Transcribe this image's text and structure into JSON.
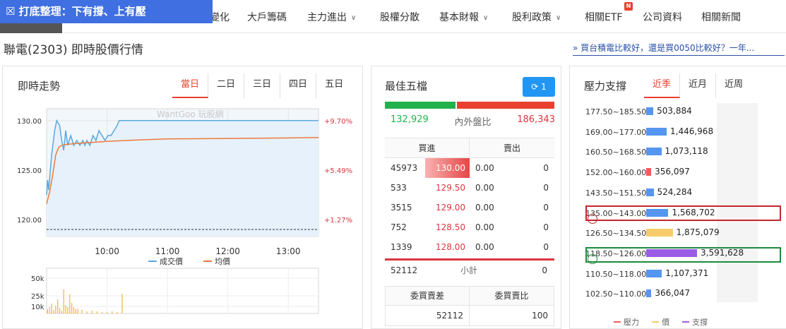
{
  "nav": {
    "banner": "☒ 打底整理：下有撐、上有壓",
    "items": [
      "變化",
      "大戶籌碼",
      "主力進出",
      "股權分散",
      "基本財報",
      "股利政策",
      "相關ETF",
      "公司資料",
      "相關新聞"
    ],
    "etf_badge": "N"
  },
  "page": {
    "title": "聯電(2303) 即時股價行情",
    "promo": "» 買台積電比較好，還是買0050比較好？一年..."
  },
  "trend": {
    "title": "即時走勢",
    "tabs": [
      "當日",
      "二日",
      "三日",
      "四日",
      "五日"
    ],
    "active_tab": 0,
    "watermark": "WantGoo 玩股網",
    "legend_price": "成交價",
    "legend_avg": "均價",
    "price_color": "#5ba8de",
    "avg_color": "#f07a3a"
  },
  "chart_data": [
    {
      "type": "line",
      "title": "",
      "x_ticks": [
        "10:00",
        "11:00",
        "12:00",
        "13:00"
      ],
      "y_ticks": [
        "130.00",
        "125.00",
        "120.00"
      ],
      "y_ticks_right": [
        "+9.70%",
        "+5.49%",
        "+1.27%"
      ],
      "ylim": [
        118.3,
        131.2
      ],
      "grid": true,
      "series": [
        {
          "name": "成交價",
          "x": [
            "09:00",
            "09:01",
            "09:02",
            "09:05",
            "09:08",
            "09:10",
            "09:13",
            "09:15",
            "09:17",
            "09:19",
            "09:21",
            "09:24",
            "09:27",
            "09:30",
            "09:33",
            "09:36",
            "09:38",
            "09:40",
            "09:43",
            "09:46",
            "09:49",
            "09:52",
            "09:55",
            "09:58",
            "10:01",
            "10:04",
            "10:07",
            "10:10",
            "10:12",
            "10:15",
            "10:20",
            "13:30"
          ],
          "values": [
            122.5,
            124.0,
            123.0,
            126.5,
            129.0,
            130.0,
            129.5,
            128.0,
            127.0,
            129.0,
            127.5,
            128.5,
            127.5,
            128.0,
            127.5,
            128.0,
            127.5,
            128.0,
            127.5,
            128.5,
            128.0,
            129.0,
            128.5,
            128.0,
            128.5,
            128.5,
            129.0,
            129.5,
            130.0,
            130.0,
            130.0,
            130.0
          ]
        },
        {
          "name": "均價",
          "x": [
            "09:00",
            "09:03",
            "09:06",
            "09:09",
            "09:12",
            "09:15",
            "09:20",
            "09:30",
            "09:45",
            "10:00",
            "10:30",
            "11:00",
            "12:00",
            "13:00",
            "13:30"
          ],
          "values": [
            121.6,
            122.8,
            124.5,
            126.5,
            127.3,
            127.5,
            127.6,
            127.7,
            127.8,
            127.9,
            128.05,
            128.15,
            128.2,
            128.25,
            128.3
          ]
        }
      ]
    },
    {
      "type": "bar",
      "title": "",
      "y_ticks": [
        "50k",
        "25k",
        "10k"
      ],
      "ylim": [
        0,
        60000
      ],
      "x": [
        "09:01",
        "09:03",
        "09:05",
        "09:07",
        "09:09",
        "09:11",
        "09:13",
        "09:15",
        "09:17",
        "09:19",
        "09:21",
        "09:23",
        "09:25",
        "09:27",
        "09:29",
        "09:31",
        "09:35",
        "09:40",
        "09:45",
        "09:50",
        "09:55",
        "10:00",
        "10:05",
        "10:10",
        "10:15"
      ],
      "values": [
        6000,
        9000,
        14000,
        5000,
        11000,
        20000,
        8000,
        4000,
        34000,
        12000,
        9000,
        27000,
        15000,
        9000,
        6000,
        7000,
        5000,
        3000,
        4000,
        3000,
        2000,
        2000,
        3000,
        2000,
        28000
      ]
    }
  ],
  "best5": {
    "title": "最佳五檔",
    "refresh_label": "1",
    "inner_vol": "132,929",
    "ratio_label": "內外盤比",
    "outer_vol": "186,343",
    "inner_ratio": 0.416,
    "buy_header": "買進",
    "sell_header": "賣出",
    "rows": [
      {
        "vol": "45973",
        "bid": "130.00",
        "ask": "0.00",
        "ask_vol": "0"
      },
      {
        "vol": "533",
        "bid": "129.50",
        "ask": "0.00",
        "ask_vol": "0"
      },
      {
        "vol": "3515",
        "bid": "129.00",
        "ask": "0.00",
        "ask_vol": "0"
      },
      {
        "vol": "752",
        "bid": "128.50",
        "ask": "0.00",
        "ask_vol": "0"
      },
      {
        "vol": "1339",
        "bid": "128.00",
        "ask": "0.00",
        "ask_vol": "0"
      }
    ],
    "subtotal_buy": "52112",
    "subtotal_label": "小計",
    "subtotal_sell": "0",
    "diff_header": "委買賣差",
    "ratio_header": "委買賣比",
    "diff_value": "52112",
    "ratio_value": "100",
    "buy_color": "#d9363e",
    "sell_color": "#22b14c"
  },
  "pressure": {
    "title": "壓力支撐",
    "tabs": [
      "近季",
      "近月",
      "近周"
    ],
    "active_tab": 0,
    "rows": [
      {
        "range": "177.50~185.50",
        "value": "503,884",
        "num": 503884,
        "kind": "normal"
      },
      {
        "range": "169.00~177.00",
        "value": "1,446,968",
        "num": 1446968,
        "kind": "normal"
      },
      {
        "range": "160.50~168.50",
        "value": "1,073,118",
        "num": 1073118,
        "kind": "normal"
      },
      {
        "range": "152.00~160.00",
        "value": "356,097",
        "num": 356097,
        "kind": "pressure"
      },
      {
        "range": "143.50~151.50",
        "value": "524,284",
        "num": 524284,
        "kind": "normal"
      },
      {
        "range": "135.00~143.00",
        "value": "1,568,702",
        "num": 1568702,
        "kind": "normal"
      },
      {
        "range": "126.50~134.50",
        "value": "1,875,079",
        "num": 1875079,
        "kind": "price"
      },
      {
        "range": "118.50~126.00",
        "value": "3,591,628",
        "num": 3591628,
        "kind": "support"
      },
      {
        "range": "110.50~118.00",
        "value": "1,107,371",
        "num": 1107371,
        "kind": "normal"
      },
      {
        "range": "102.50~110.00",
        "value": "366,047",
        "num": 366047,
        "kind": "normal"
      }
    ],
    "legend": [
      "壓力",
      "價",
      "支撐"
    ],
    "colors": {
      "normal": "#5596f0",
      "pressure": "#f25b5b",
      "price": "#f8cc6a",
      "support": "#9b5de5"
    },
    "highlight_red": "#c1272d",
    "highlight_green": "#1e8a3a"
  }
}
